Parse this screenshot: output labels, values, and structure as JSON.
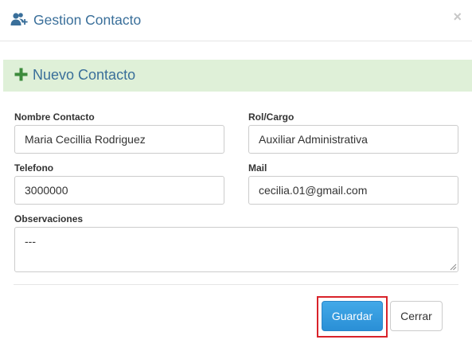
{
  "header": {
    "icon": "users-add-icon",
    "title": "Gestion Contacto",
    "close_label": "×"
  },
  "section": {
    "icon": "plus-icon",
    "title": "Nuevo Contacto"
  },
  "form": {
    "nombre": {
      "label": "Nombre Contacto",
      "value": "Maria Cecillia Rodriguez"
    },
    "rol": {
      "label": "Rol/Cargo",
      "value": "Auxiliar Administrativa"
    },
    "telefono": {
      "label": "Telefono",
      "value": "3000000"
    },
    "mail": {
      "label": "Mail",
      "value": "cecilia.01@gmail.com"
    },
    "observaciones": {
      "label": "Observaciones",
      "value": "---"
    }
  },
  "footer": {
    "save_label": "Guardar",
    "close_label": "Cerrar"
  },
  "colors": {
    "title": "#3a6f9a",
    "banner_bg": "#dff0d8",
    "plus": "#3c8b3c",
    "primary": "#2a8fd6",
    "highlight": "#d9232a"
  }
}
